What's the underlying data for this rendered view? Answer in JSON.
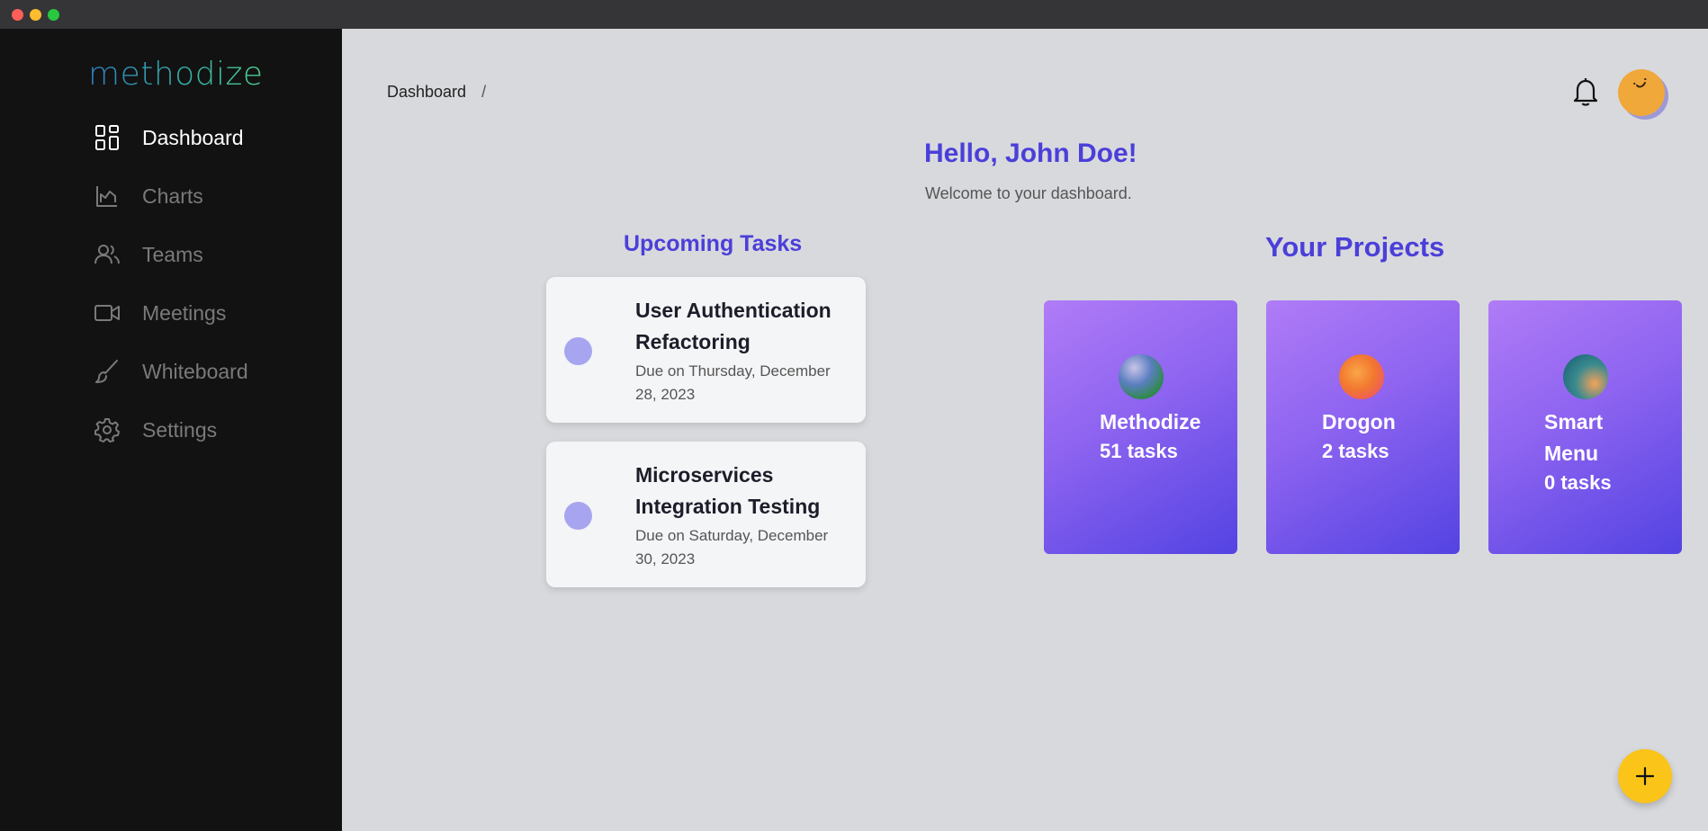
{
  "app": {
    "logo": "methodize"
  },
  "sidebar": {
    "items": [
      {
        "label": "Dashboard",
        "icon": "dashboard-icon",
        "active": true
      },
      {
        "label": "Charts",
        "icon": "chart-icon",
        "active": false
      },
      {
        "label": "Teams",
        "icon": "users-icon",
        "active": false
      },
      {
        "label": "Meetings",
        "icon": "video-icon",
        "active": false
      },
      {
        "label": "Whiteboard",
        "icon": "brush-icon",
        "active": false
      },
      {
        "label": "Settings",
        "icon": "gear-icon",
        "active": false
      }
    ]
  },
  "header": {
    "breadcrumb": "Dashboard",
    "breadcrumb_separator": "/",
    "icons": [
      "bell-icon",
      "avatar"
    ]
  },
  "greeting": {
    "title": "Hello, John Doe!",
    "subtitle": "Welcome to your dashboard."
  },
  "upcoming": {
    "title": "Upcoming Tasks",
    "tasks": [
      {
        "title": "User Authentication Refactoring",
        "due": "Due on Thursday, December 28, 2023"
      },
      {
        "title": "Microservices Integration Testing",
        "due": "Due on Saturday, December 30, 2023"
      }
    ]
  },
  "projects": {
    "title": "Your Projects",
    "items": [
      {
        "name": "Methodize",
        "tasks": "51 tasks"
      },
      {
        "name": "Drogon",
        "tasks": "2 tasks"
      },
      {
        "name": "Smart Menu",
        "tasks": "0 tasks"
      }
    ]
  },
  "fab": {
    "icon": "plus-icon"
  },
  "colors": {
    "accent": "#4b3fd9",
    "sidebar_bg": "#121212",
    "main_bg": "#d8d9dd",
    "fab": "#fbc418",
    "task_dot": "#a7a5f0"
  }
}
